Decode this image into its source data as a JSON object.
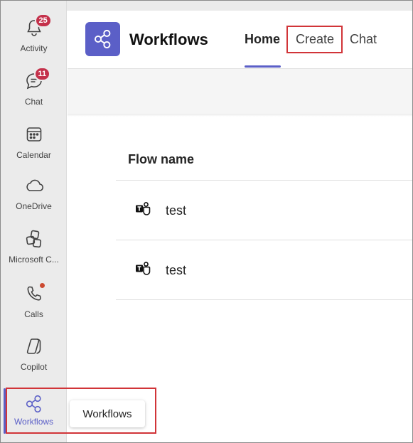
{
  "rail": {
    "items": [
      {
        "label": "Activity",
        "icon": "bell-icon",
        "badge": "25"
      },
      {
        "label": "Chat",
        "icon": "chat-icon",
        "badge": "11"
      },
      {
        "label": "Calendar",
        "icon": "calendar-icon"
      },
      {
        "label": "OneDrive",
        "icon": "cloud-icon"
      },
      {
        "label": "Microsoft C...",
        "icon": "copilot-apps-icon"
      },
      {
        "label": "Calls",
        "icon": "phone-icon"
      },
      {
        "label": "Copilot",
        "icon": "copilot-icon"
      },
      {
        "label": "Workflows",
        "icon": "workflows-icon",
        "active": true
      }
    ],
    "tooltip": "Workflows"
  },
  "header": {
    "app_title": "Workflows",
    "tabs": [
      {
        "label": "Home",
        "active": true
      },
      {
        "label": "Create"
      },
      {
        "label": "Chat"
      }
    ]
  },
  "table": {
    "column_header": "Flow name",
    "rows": [
      {
        "name": "test",
        "icon": "teams-icon"
      },
      {
        "name": "test",
        "icon": "teams-icon"
      }
    ]
  },
  "colors": {
    "accent": "#5b5fc7",
    "badge": "#c4314b",
    "highlight": "#d13438",
    "rail_bg": "#ebebeb"
  }
}
